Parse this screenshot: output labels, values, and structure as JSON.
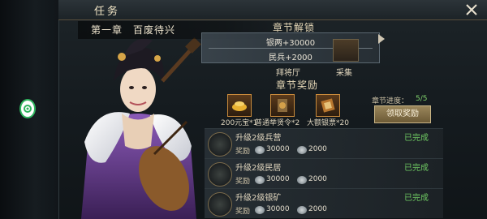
{
  "window": {
    "title": "任务"
  },
  "chapter": {
    "title": "第一章　百废待兴",
    "unlock_title": "章节解锁",
    "unlock_tooltip": [
      "银两+30000",
      "民兵+2000"
    ],
    "buildings": [
      {
        "label": "拜将厅",
        "icon": "hall-building-icon"
      },
      {
        "label": "采集",
        "icon": "gather-building-icon"
      }
    ],
    "reward_title": "章节奖励",
    "rewards": [
      {
        "label": "200元宝*1",
        "icon": "gold-ingot-icon"
      },
      {
        "label": "普通举贤令*2",
        "icon": "recruit-token-icon"
      },
      {
        "label": "大额银票*20",
        "icon": "silver-note-icon"
      }
    ],
    "progress_label": "章节进度：",
    "progress_value": "5/5",
    "claim_button": "领取奖励"
  },
  "tasks": [
    {
      "name": "升级2级兵营",
      "reward_label": "奖励",
      "silver": "30000",
      "troops": "2000",
      "status": "已完成"
    },
    {
      "name": "升级2级民居",
      "reward_label": "奖励",
      "silver": "30000",
      "troops": "2000",
      "status": "已完成"
    },
    {
      "name": "升级2级银矿",
      "reward_label": "奖励",
      "silver": "30000",
      "troops": "2000",
      "status": "已完成"
    }
  ],
  "colors": {
    "complete": "#6ec862",
    "progress": "#7fd06b",
    "accent": "#c9b586"
  }
}
